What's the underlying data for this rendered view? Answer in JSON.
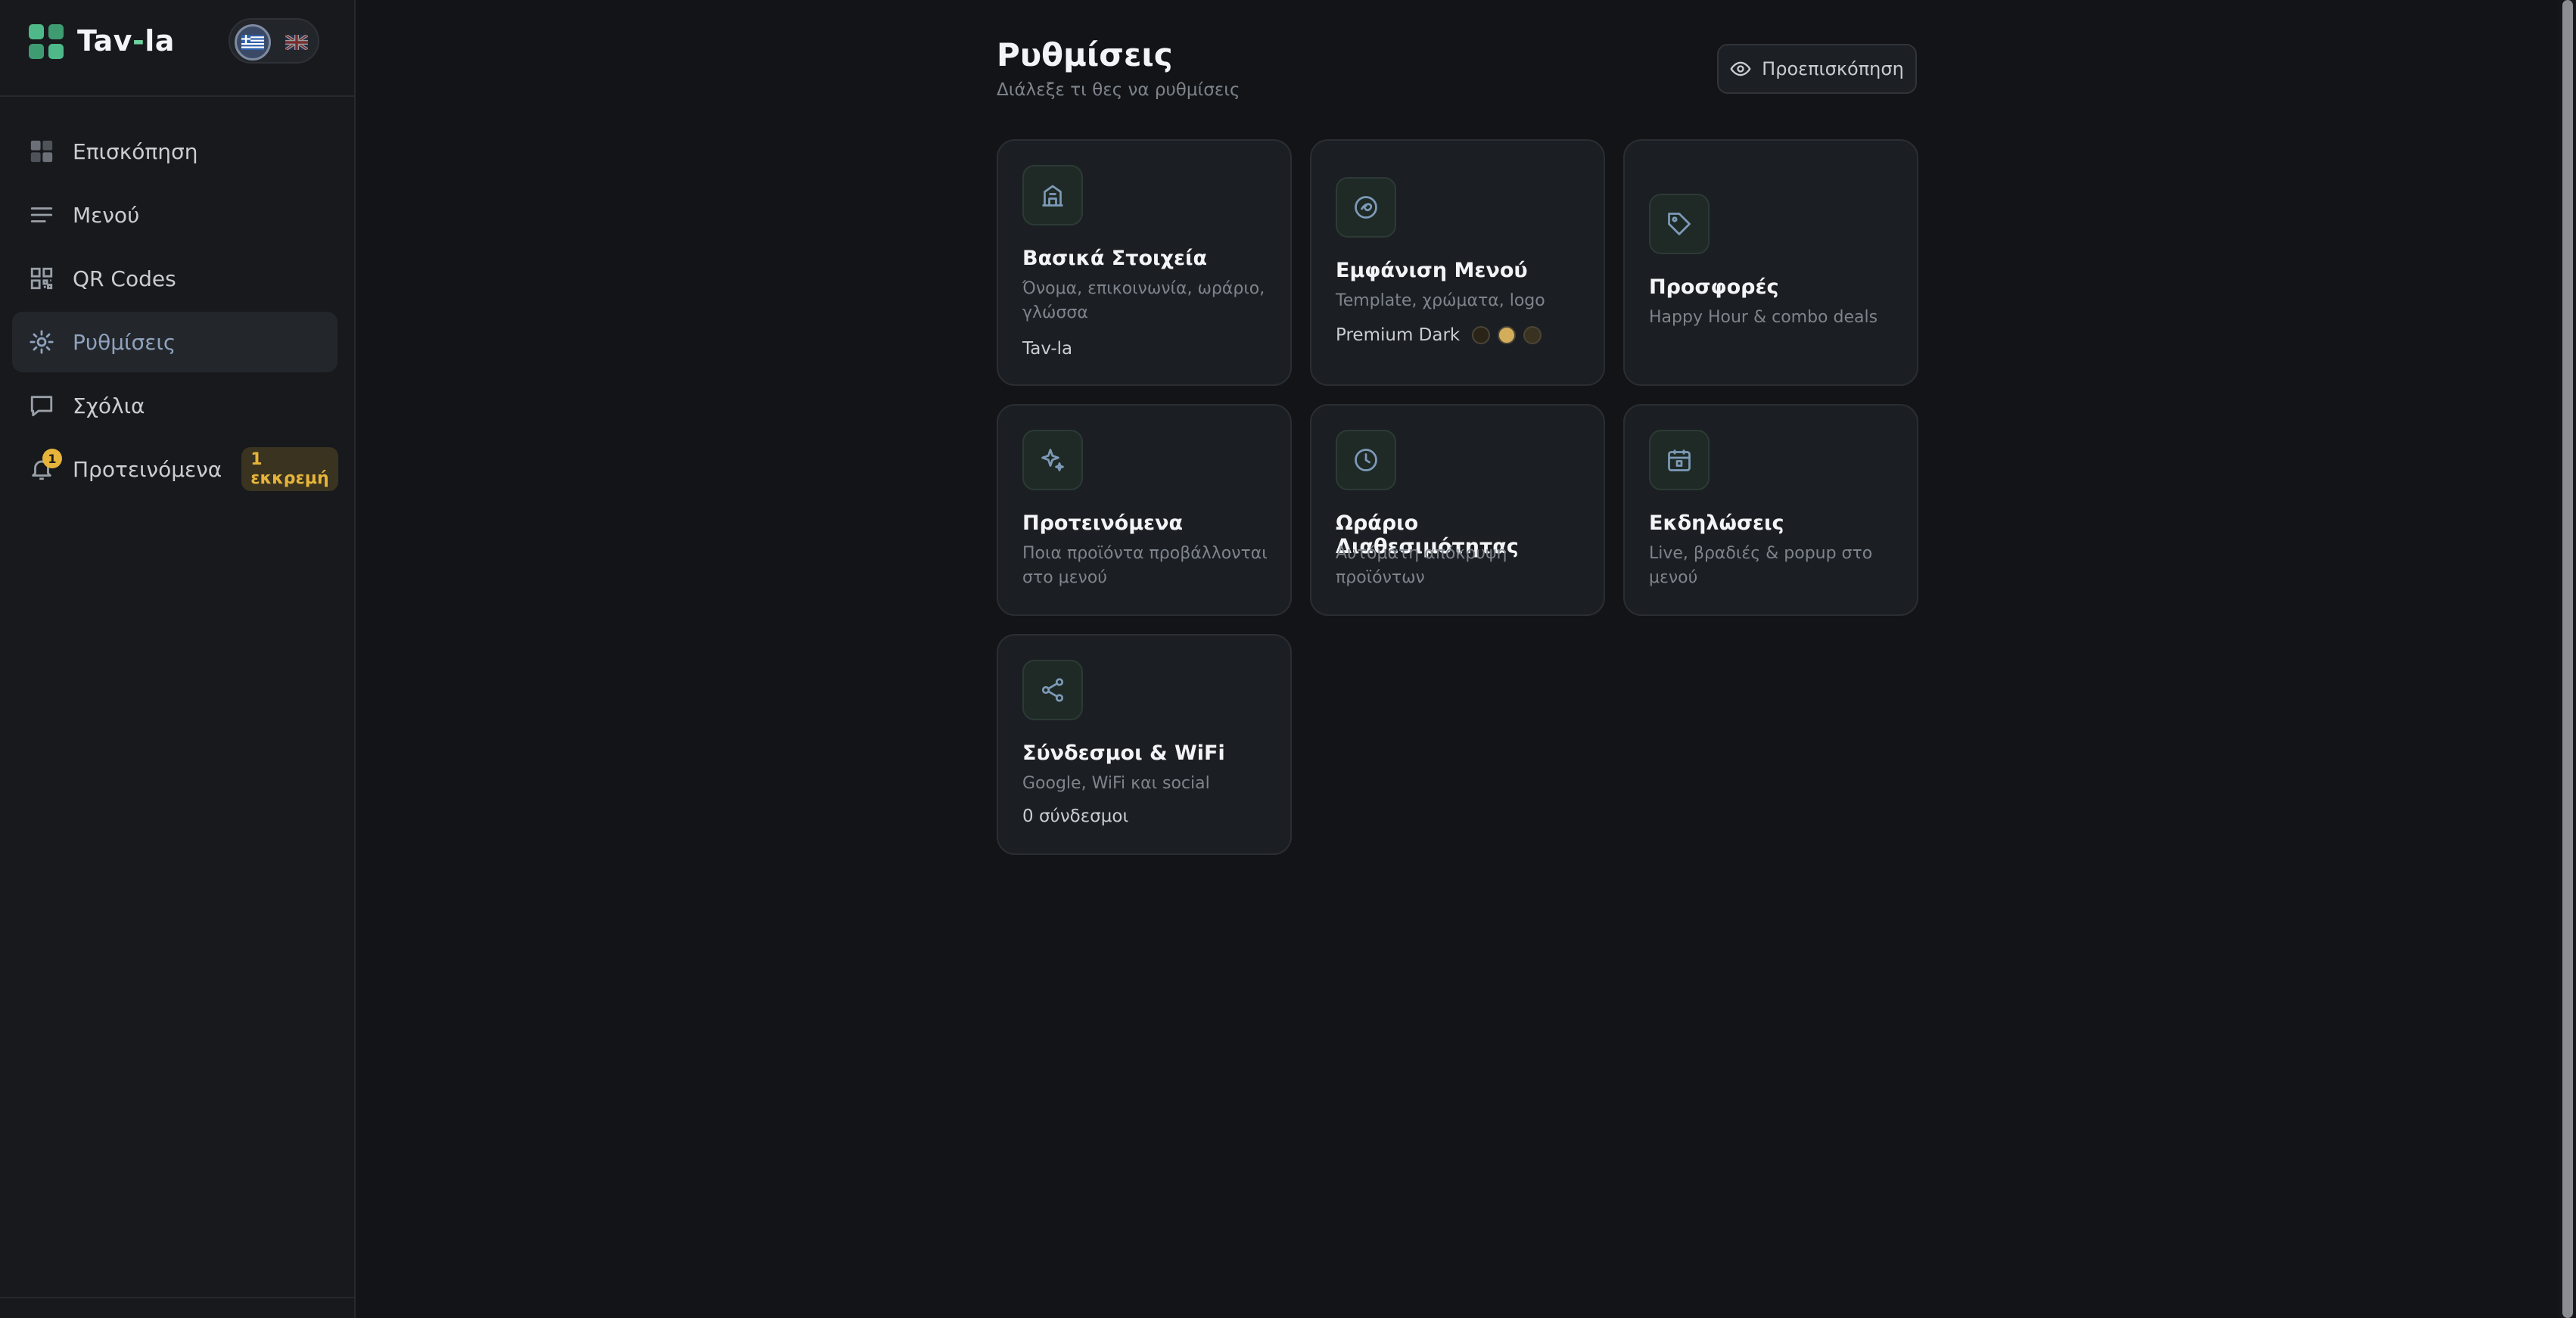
{
  "brand": {
    "name_main": "Tav",
    "name_dash": "-",
    "name_end": "la",
    "logo_colors": [
      "#4fb889",
      "#3f9b72",
      "#3f9b72",
      "#4fb889"
    ]
  },
  "lang": {
    "active": "gr",
    "options": [
      "gr",
      "uk"
    ]
  },
  "sidebar": {
    "items": [
      {
        "label": "Επισκόπηση",
        "icon": "dashboard-icon"
      },
      {
        "label": "Μενού",
        "icon": "menu-lines-icon"
      },
      {
        "label": "QR Codes",
        "icon": "qr-code-icon"
      },
      {
        "label": "Ρυθμίσεις",
        "icon": "gear-icon",
        "active": true
      },
      {
        "label": "Σχόλια",
        "icon": "comment-icon"
      },
      {
        "label": "Προτεινόμενα",
        "icon": "bell-icon",
        "notification_count": "1",
        "badge": "1 εκκρεμή"
      }
    ]
  },
  "header": {
    "title": "Ρυθμίσεις",
    "subtitle": "Διάλεξε τι θες να ρυθμίσεις",
    "preview_label": "Προεπισκόπηση"
  },
  "cards": [
    {
      "title": "Βασικά Στοιχεία",
      "desc": "Όνομα, επικοινωνία, ωράριο, γλώσσα",
      "meta": "Tav-la",
      "icon": "building-icon"
    },
    {
      "title": "Εμφάνιση Μενού",
      "desc": "Template, χρώματα, logo",
      "meta": "Premium Dark",
      "icon": "palette-icon",
      "swatches": [
        "#2a2418",
        "#d4ad5a",
        "#3a3220"
      ]
    },
    {
      "title": "Προσφορές",
      "desc": "Happy Hour & combo deals",
      "meta": "",
      "icon": "tag-icon"
    },
    {
      "title": "Προτεινόμενα",
      "desc": "Ποια προϊόντα προβάλλονται στο μενού",
      "meta": "",
      "icon": "sparkle-icon"
    },
    {
      "title": "Ωράριο Διαθεσιμότητας",
      "desc": "Αυτόματη απόκρυψη προϊόντων",
      "meta": "",
      "icon": "clock-icon"
    },
    {
      "title": "Εκδηλώσεις",
      "desc": "Live, βραδιές & popup στο μενού",
      "meta": "",
      "icon": "calendar-icon"
    },
    {
      "title": "Σύνδεσμοι & WiFi",
      "desc": "Google, WiFi και social",
      "meta": "0 σύνδεσμοι",
      "icon": "share-icon"
    }
  ],
  "colors": {
    "accent_icon": "#7d9bb8",
    "badge": "#e6b43a",
    "brand_green": "#4fb889"
  }
}
